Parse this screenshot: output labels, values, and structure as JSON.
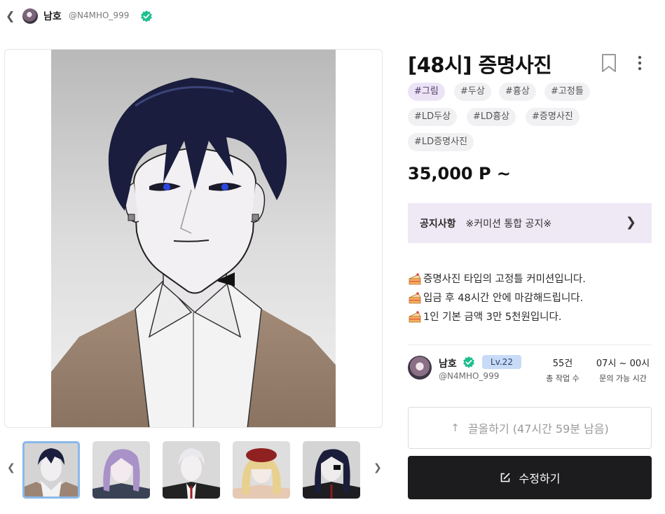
{
  "header": {
    "back_icon": "chevron-left-icon",
    "author_name": "남호",
    "author_handle": "@N4MHO_999",
    "verified_icon": "verified-check-icon"
  },
  "product": {
    "title": "[48시] 증명사진",
    "bookmark_icon": "bookmark-icon",
    "more_icon": "more-vertical-icon",
    "tags": [
      "#그림",
      "#두상",
      "#흉상",
      "#고정틀",
      "#LD두상",
      "#LD흉상",
      "#증명사진",
      "#LD증명사진"
    ],
    "price": "35,000 P ~"
  },
  "notice": {
    "label": "공지사항",
    "text": "※커미션 통합 공지※",
    "arrow_icon": "chevron-right-icon"
  },
  "description": [
    "증명사진 타입의 고정틀 커미션입니다.",
    "입금 후 48시간 안에 마감해드립니다.",
    "1인 기본 금액 3만 5천원입니다."
  ],
  "creator": {
    "name": "남호",
    "handle": "@N4MHO_999",
    "level": "Lv.22",
    "works_value": "55건",
    "works_label": "총 작업 수",
    "hours_value": "07시 ~ 00시",
    "hours_label": "문의 가능 시간"
  },
  "buttons": {
    "bump_label": "끌올하기 (47시간 59분 남음)",
    "edit_label": "수정하기"
  },
  "gallery": {
    "prev_icon": "chevron-left-icon",
    "next_icon": "chevron-right-icon",
    "selected_index": 0,
    "thumbnail_count": 5
  },
  "colors": {
    "tag_active_bg": "#ece4f6",
    "notice_bg": "#efe8f5",
    "level_badge_bg": "#c7dbf7",
    "verified_green": "#1fbf8f",
    "edit_button_bg": "#1c1c1e"
  }
}
